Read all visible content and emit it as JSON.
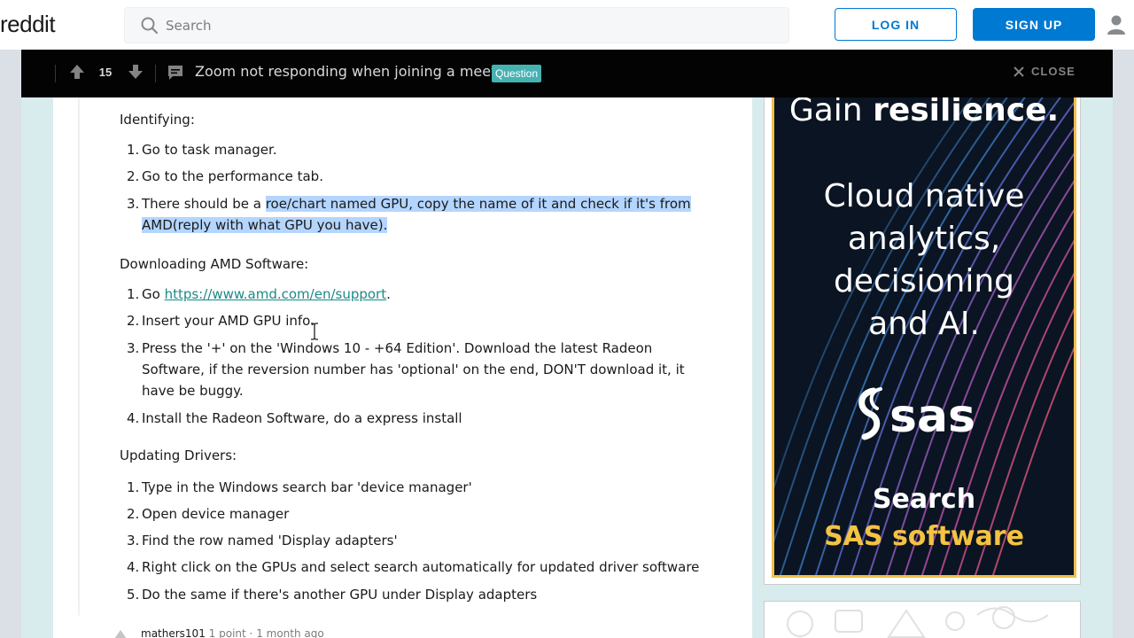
{
  "header": {
    "logo_text": "reddit",
    "search_placeholder": "Search",
    "login_label": "LOG IN",
    "signup_label": "SIGN UP"
  },
  "post_bar": {
    "score": "15",
    "title": "Zoom not responding when joining a meeting",
    "flair": "Question",
    "close_label": "CLOSE"
  },
  "comment": {
    "identifying": {
      "heading": "Identifying:",
      "items": [
        {
          "num": "1.",
          "text": "Go to task manager."
        },
        {
          "num": "2.",
          "text": "Go to the performance tab."
        },
        {
          "num": "3.",
          "text_plain": "There should be a ",
          "text_highlight": "roe/chart named GPU, copy the name of it and check if it's from AMD(reply with what GPU you have)."
        }
      ]
    },
    "downloading": {
      "heading": "Downloading AMD Software:",
      "items": [
        {
          "num": "1.",
          "prefix": "Go ",
          "link": "https://www.amd.com/en/support",
          "suffix": "."
        },
        {
          "num": "2.",
          "text": "Insert your AMD GPU info."
        },
        {
          "num": "3.",
          "text": "Press the '+' on the 'Windows 10 - +64 Edition'. Download the latest Radeon Software, if the reversion number has 'optional' on the end, DON'T download it, it have be buggy."
        },
        {
          "num": "4.",
          "text": "Install the Radeon Software, do a express install"
        }
      ]
    },
    "updating": {
      "heading": "Updating Drivers:",
      "items": [
        {
          "num": "1.",
          "text": "Type in the Windows search bar 'device manager'"
        },
        {
          "num": "2.",
          "text": "Open device manager"
        },
        {
          "num": "3.",
          "text": "Find the row named 'Display adapters'"
        },
        {
          "num": "4.",
          "text": "Right click on the GPUs and select search automatically for updated driver software"
        },
        {
          "num": "5.",
          "text": "Do the same if there's another GPU under Display adapters"
        }
      ]
    }
  },
  "next_comment": {
    "author": "mathers101",
    "points": "1 point",
    "separator": "·",
    "age": "1 month ago"
  },
  "ad": {
    "line1_light": "Gain ",
    "line1_bold": "resilience.",
    "big_lines": [
      "Cloud native",
      "analytics,",
      "decisioning",
      "and AI."
    ],
    "logo_text": "sas",
    "search_line": "Search",
    "brand_line": "SAS software",
    "accent_color": "#f1c04a"
  },
  "colors": {
    "brand_blue": "#0079d3",
    "flair_bg": "#46b2b2",
    "highlight": "#b4d5fe",
    "overlay_bg": "#d8ecee",
    "postbar_bg": "#030303"
  }
}
